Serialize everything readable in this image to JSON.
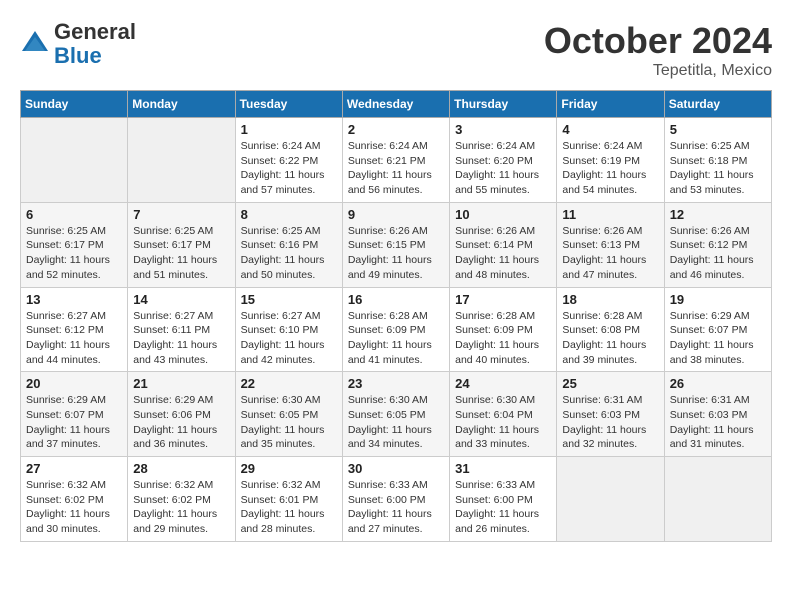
{
  "header": {
    "logo": {
      "general": "General",
      "blue": "Blue"
    },
    "title": "October 2024",
    "location": "Tepetitla, Mexico"
  },
  "days_of_week": [
    "Sunday",
    "Monday",
    "Tuesday",
    "Wednesday",
    "Thursday",
    "Friday",
    "Saturday"
  ],
  "weeks": [
    [
      {
        "day": "",
        "info": ""
      },
      {
        "day": "",
        "info": ""
      },
      {
        "day": "1",
        "info": "Sunrise: 6:24 AM\nSunset: 6:22 PM\nDaylight: 11 hours and 57 minutes."
      },
      {
        "day": "2",
        "info": "Sunrise: 6:24 AM\nSunset: 6:21 PM\nDaylight: 11 hours and 56 minutes."
      },
      {
        "day": "3",
        "info": "Sunrise: 6:24 AM\nSunset: 6:20 PM\nDaylight: 11 hours and 55 minutes."
      },
      {
        "day": "4",
        "info": "Sunrise: 6:24 AM\nSunset: 6:19 PM\nDaylight: 11 hours and 54 minutes."
      },
      {
        "day": "5",
        "info": "Sunrise: 6:25 AM\nSunset: 6:18 PM\nDaylight: 11 hours and 53 minutes."
      }
    ],
    [
      {
        "day": "6",
        "info": "Sunrise: 6:25 AM\nSunset: 6:17 PM\nDaylight: 11 hours and 52 minutes."
      },
      {
        "day": "7",
        "info": "Sunrise: 6:25 AM\nSunset: 6:17 PM\nDaylight: 11 hours and 51 minutes."
      },
      {
        "day": "8",
        "info": "Sunrise: 6:25 AM\nSunset: 6:16 PM\nDaylight: 11 hours and 50 minutes."
      },
      {
        "day": "9",
        "info": "Sunrise: 6:26 AM\nSunset: 6:15 PM\nDaylight: 11 hours and 49 minutes."
      },
      {
        "day": "10",
        "info": "Sunrise: 6:26 AM\nSunset: 6:14 PM\nDaylight: 11 hours and 48 minutes."
      },
      {
        "day": "11",
        "info": "Sunrise: 6:26 AM\nSunset: 6:13 PM\nDaylight: 11 hours and 47 minutes."
      },
      {
        "day": "12",
        "info": "Sunrise: 6:26 AM\nSunset: 6:12 PM\nDaylight: 11 hours and 46 minutes."
      }
    ],
    [
      {
        "day": "13",
        "info": "Sunrise: 6:27 AM\nSunset: 6:12 PM\nDaylight: 11 hours and 44 minutes."
      },
      {
        "day": "14",
        "info": "Sunrise: 6:27 AM\nSunset: 6:11 PM\nDaylight: 11 hours and 43 minutes."
      },
      {
        "day": "15",
        "info": "Sunrise: 6:27 AM\nSunset: 6:10 PM\nDaylight: 11 hours and 42 minutes."
      },
      {
        "day": "16",
        "info": "Sunrise: 6:28 AM\nSunset: 6:09 PM\nDaylight: 11 hours and 41 minutes."
      },
      {
        "day": "17",
        "info": "Sunrise: 6:28 AM\nSunset: 6:09 PM\nDaylight: 11 hours and 40 minutes."
      },
      {
        "day": "18",
        "info": "Sunrise: 6:28 AM\nSunset: 6:08 PM\nDaylight: 11 hours and 39 minutes."
      },
      {
        "day": "19",
        "info": "Sunrise: 6:29 AM\nSunset: 6:07 PM\nDaylight: 11 hours and 38 minutes."
      }
    ],
    [
      {
        "day": "20",
        "info": "Sunrise: 6:29 AM\nSunset: 6:07 PM\nDaylight: 11 hours and 37 minutes."
      },
      {
        "day": "21",
        "info": "Sunrise: 6:29 AM\nSunset: 6:06 PM\nDaylight: 11 hours and 36 minutes."
      },
      {
        "day": "22",
        "info": "Sunrise: 6:30 AM\nSunset: 6:05 PM\nDaylight: 11 hours and 35 minutes."
      },
      {
        "day": "23",
        "info": "Sunrise: 6:30 AM\nSunset: 6:05 PM\nDaylight: 11 hours and 34 minutes."
      },
      {
        "day": "24",
        "info": "Sunrise: 6:30 AM\nSunset: 6:04 PM\nDaylight: 11 hours and 33 minutes."
      },
      {
        "day": "25",
        "info": "Sunrise: 6:31 AM\nSunset: 6:03 PM\nDaylight: 11 hours and 32 minutes."
      },
      {
        "day": "26",
        "info": "Sunrise: 6:31 AM\nSunset: 6:03 PM\nDaylight: 11 hours and 31 minutes."
      }
    ],
    [
      {
        "day": "27",
        "info": "Sunrise: 6:32 AM\nSunset: 6:02 PM\nDaylight: 11 hours and 30 minutes."
      },
      {
        "day": "28",
        "info": "Sunrise: 6:32 AM\nSunset: 6:02 PM\nDaylight: 11 hours and 29 minutes."
      },
      {
        "day": "29",
        "info": "Sunrise: 6:32 AM\nSunset: 6:01 PM\nDaylight: 11 hours and 28 minutes."
      },
      {
        "day": "30",
        "info": "Sunrise: 6:33 AM\nSunset: 6:00 PM\nDaylight: 11 hours and 27 minutes."
      },
      {
        "day": "31",
        "info": "Sunrise: 6:33 AM\nSunset: 6:00 PM\nDaylight: 11 hours and 26 minutes."
      },
      {
        "day": "",
        "info": ""
      },
      {
        "day": "",
        "info": ""
      }
    ]
  ]
}
